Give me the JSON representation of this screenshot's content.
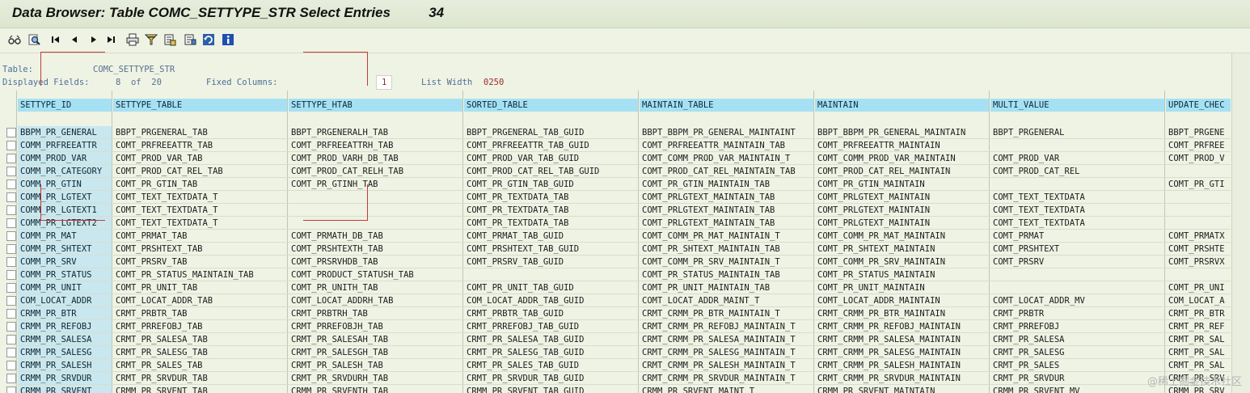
{
  "window": {
    "title": "Data Browser: Table COMC_SETTYPE_STR Select Entries",
    "count": "34"
  },
  "toolbar": {
    "buttons": [
      {
        "name": "glasses-icon"
      },
      {
        "name": "detail-icon"
      },
      {
        "name": "first-page-icon"
      },
      {
        "name": "previous-page-icon"
      },
      {
        "name": "next-page-icon"
      },
      {
        "name": "last-page-icon"
      },
      {
        "name": "print-icon"
      },
      {
        "name": "filter-icon"
      },
      {
        "name": "export-icon"
      },
      {
        "name": "layout-icon"
      },
      {
        "name": "refresh-icon"
      },
      {
        "name": "information-icon"
      }
    ]
  },
  "info": {
    "table_label": "Table:",
    "table_value": "COMC_SETTYPE_STR",
    "displayed_label": "Displayed Fields:",
    "displayed_value": "8  of  20",
    "fixed_label": "Fixed Columns:",
    "fixed_value": "1",
    "width_label": "List Width",
    "width_value": "0250"
  },
  "grid": {
    "columns": [
      "SETTYPE_ID",
      "SETTYPE_TABLE",
      "SETTYPE_HTAB",
      "SORTED_TABLE",
      "MAINTAIN_TABLE",
      "MAINTAIN",
      "MULTI_VALUE",
      "UPDATE_CHEC"
    ],
    "rows": [
      [
        "BBPM_PR_GENERAL",
        "BBPT_PRGENERAL_TAB",
        "BBPT_PRGENERALH_TAB",
        "BBPT_PRGENERAL_TAB_GUID",
        "BBPT_BBPM_PR_GENERAL_MAINTAINT",
        "BBPT_BBPM_PR_GENERAL_MAINTAIN",
        "BBPT_PRGENERAL",
        "BBPT_PRGENE"
      ],
      [
        "COMM_PRFREEATTR",
        "COMT_PRFREEATTR_TAB",
        "COMT_PRFREEATTRH_TAB",
        "COMT_PRFREEATTR_TAB_GUID",
        "COMT_PRFREEATTR_MAINTAIN_TAB",
        "COMT_PRFREEATTR_MAINTAIN",
        "",
        "COMT_PRFREE"
      ],
      [
        "COMM_PROD_VAR",
        "COMT_PROD_VAR_TAB",
        "COMT_PROD_VARH_DB_TAB",
        "COMT_PROD_VAR_TAB_GUID",
        "COMT_COMM_PROD_VAR_MAINTAIN_T",
        "COMT_COMM_PROD_VAR_MAINTAIN",
        "COMT_PROD_VAR",
        "COMT_PROD_V"
      ],
      [
        "COMM_PR_CATEGORY",
        "COMT_PROD_CAT_REL_TAB",
        "COMT_PROD_CAT_RELH_TAB",
        "COMT_PROD_CAT_REL_TAB_GUID",
        "COMT_PROD_CAT_REL_MAINTAIN_TAB",
        "COMT_PROD_CAT_REL_MAINTAIN",
        "COMT_PROD_CAT_REL",
        ""
      ],
      [
        "COMM_PR_GTIN",
        "COMT_PR_GTIN_TAB",
        "COMT_PR_GTINH_TAB",
        "COMT_PR_GTIN_TAB_GUID",
        "COMT_PR_GTIN_MAINTAIN_TAB",
        "COMT_PR_GTIN_MAINTAIN",
        "",
        "COMT_PR_GTI"
      ],
      [
        "COMM_PR_LGTEXT",
        "COMT_TEXT_TEXTDATA_T",
        "",
        "COMT_PR_TEXTDATA_TAB",
        "COMT_PRLGTEXT_MAINTAIN_TAB",
        "COMT_PRLGTEXT_MAINTAIN",
        "COMT_TEXT_TEXTDATA",
        ""
      ],
      [
        "COMM_PR_LGTEXT1",
        "COMT_TEXT_TEXTDATA_T",
        "",
        "COMT_PR_TEXTDATA_TAB",
        "COMT_PRLGTEXT_MAINTAIN_TAB",
        "COMT_PRLGTEXT_MAINTAIN",
        "COMT_TEXT_TEXTDATA",
        ""
      ],
      [
        "COMM_PR_LGTEXT2",
        "COMT_TEXT_TEXTDATA_T",
        "",
        "COMT_PR_TEXTDATA_TAB",
        "COMT_PRLGTEXT_MAINTAIN_TAB",
        "COMT_PRLGTEXT_MAINTAIN",
        "COMT_TEXT_TEXTDATA",
        ""
      ],
      [
        "COMM_PR_MAT",
        "COMT_PRMAT_TAB",
        "COMT_PRMATH_DB_TAB",
        "COMT_PRMAT_TAB_GUID",
        "COMT_COMM_PR_MAT_MAINTAIN_T",
        "COMT_COMM_PR_MAT_MAINTAIN",
        "COMT_PRMAT",
        "COMT_PRMATX"
      ],
      [
        "COMM_PR_SHTEXT",
        "COMT_PRSHTEXT_TAB",
        "COMT_PRSHTEXTH_TAB",
        "COMT_PRSHTEXT_TAB_GUID",
        "COMT_PR_SHTEXT_MAINTAIN_TAB",
        "COMT_PR_SHTEXT_MAINTAIN",
        "COMT_PRSHTEXT",
        "COMT_PRSHTE"
      ],
      [
        "COMM_PR_SRV",
        "COMT_PRSRV_TAB",
        "COMT_PRSRVHDB_TAB",
        "COMT_PRSRV_TAB_GUID",
        "COMT_COMM_PR_SRV_MAINTAIN_T",
        "COMT_COMM_PR_SRV_MAINTAIN",
        "COMT_PRSRV",
        "COMT_PRSRVX"
      ],
      [
        "COMM_PR_STATUS",
        "COMT_PR_STATUS_MAINTAIN_TAB",
        "COMT_PRODUCT_STATUSH_TAB",
        "",
        "COMT_PR_STATUS_MAINTAIN_TAB",
        "COMT_PR_STATUS_MAINTAIN",
        "",
        ""
      ],
      [
        "COMM_PR_UNIT",
        "COMT_PR_UNIT_TAB",
        "COMT_PR_UNITH_TAB",
        "COMT_PR_UNIT_TAB_GUID",
        "COMT_PR_UNIT_MAINTAIN_TAB",
        "COMT_PR_UNIT_MAINTAIN",
        "",
        "COMT_PR_UNI"
      ],
      [
        "COM_LOCAT_ADDR",
        "COMT_LOCAT_ADDR_TAB",
        "COMT_LOCAT_ADDRH_TAB",
        "COM_LOCAT_ADDR_TAB_GUID",
        "COMT_LOCAT_ADDR_MAINT_T",
        "COMT_LOCAT_ADDR_MAINTAIN",
        "COMT_LOCAT_ADDR_MV",
        "COM_LOCAT_A"
      ],
      [
        "CRMM_PR_BTR",
        "CRMT_PRBTR_TAB",
        "CRMT_PRBTRH_TAB",
        "CRMT_PRBTR_TAB_GUID",
        "CRMT_CRMM_PR_BTR_MAINTAIN_T",
        "CRMT_CRMM_PR_BTR_MAINTAIN",
        "CRMT_PRBTR",
        "CRMT_PR_BTR"
      ],
      [
        "CRMM_PR_REFOBJ",
        "CRMT_PRREFOBJ_TAB",
        "CRMT_PRREFOBJH_TAB",
        "CRMT_PRREFOBJ_TAB_GUID",
        "CRMT_CRMM_PR_REFOBJ_MAINTAIN_T",
        "CRMT_CRMM_PR_REFOBJ_MAINTAIN",
        "CRMT_PRREFOBJ",
        "CRMT_PR_REF"
      ],
      [
        "CRMM_PR_SALESA",
        "CRMT_PR_SALESA_TAB",
        "CRMT_PR_SALESAH_TAB",
        "CRMT_PR_SALESA_TAB_GUID",
        "CRMT_CRMM_PR_SALESA_MAINTAIN_T",
        "CRMT_CRMM_PR_SALESA_MAINTAIN",
        "CRMT_PR_SALESA",
        "CRMT_PR_SAL"
      ],
      [
        "CRMM_PR_SALESG",
        "CRMT_PR_SALESG_TAB",
        "CRMT_PR_SALESGH_TAB",
        "CRMT_PR_SALESG_TAB_GUID",
        "CRMT_CRMM_PR_SALESG_MAINTAIN_T",
        "CRMT_CRMM_PR_SALESG_MAINTAIN",
        "CRMT_PR_SALESG",
        "CRMT_PR_SAL"
      ],
      [
        "CRMM_PR_SALESH",
        "CRMT_PR_SALES_TAB",
        "CRMT_PR_SALESH_TAB",
        "CRMT_PR_SALES_TAB_GUID",
        "CRMT_CRMM_PR_SALESH_MAINTAIN_T",
        "CRMT_CRMM_PR_SALESH_MAINTAIN",
        "CRMT_PR_SALES",
        "CRMT_PR_SAL"
      ],
      [
        "CRMM_PR_SRVDUR",
        "CRMT_PR_SRVDUR_TAB",
        "CRMT_PR_SRVDURH_TAB",
        "CRMT_PR_SRVDUR_TAB_GUID",
        "CRMT_CRMM_PR_SRVDUR_MAINTAIN_T",
        "CRMT_CRMM_PR_SRVDUR_MAINTAIN",
        "CRMT_PR_SRVDUR",
        "CRMT_PR_SRV"
      ],
      [
        "CRMM_PR_SRVENT",
        "CRMM_PR_SRVENT_TAB",
        "CRMM_PR_SRVENTH_TAB",
        "CRMM_PR_SRVENT_TAB_GUID",
        "CRMM_PR_SRVENT_MAINT_T",
        "CRMM_PR_SRVENT_MAINTAIN",
        "CRMM_PR_SRVENT_MV",
        "CRMM_PR_SRV"
      ]
    ]
  },
  "watermark": "@稀土掘金技术社区"
}
